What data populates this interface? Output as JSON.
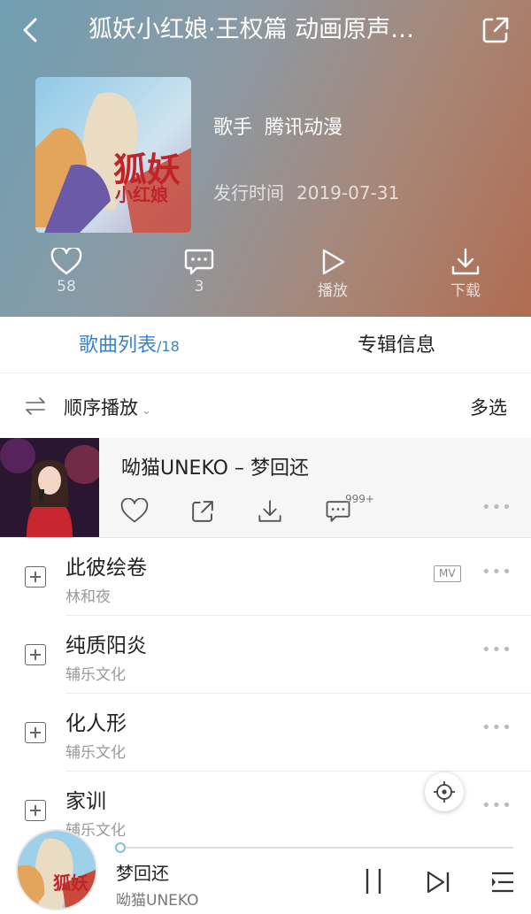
{
  "header": {
    "title": "狐妖小红娘·王权篇 动画原声…",
    "artist_label": "歌手",
    "artist_name": "腾讯动漫",
    "release_label": "发行时间",
    "release_date": "2019-07-31"
  },
  "actions": {
    "like_count": "58",
    "comment_count": "3",
    "play_label": "播放",
    "download_label": "下载"
  },
  "tabs": {
    "songs_label": "歌曲列表",
    "songs_count": "/18",
    "album_info_label": "专辑信息"
  },
  "toolbar": {
    "play_order_label": "顺序播放",
    "multi_select_label": "多选"
  },
  "now_playing": {
    "title": "呦猫UNEKO – 梦回还",
    "comment_badge": "999+"
  },
  "songs": [
    {
      "name": "此彼绘卷",
      "artist": "林和夜",
      "mv": "MV"
    },
    {
      "name": "纯质阳炎",
      "artist": "辅乐文化"
    },
    {
      "name": "化人形",
      "artist": "辅乐文化"
    },
    {
      "name": "家训",
      "artist": "辅乐文化"
    }
  ],
  "player": {
    "song": "梦回还",
    "artist": "呦猫UNEKO",
    "progress": 0.01
  },
  "colors": {
    "accent": "#3b82c4",
    "progress": "#7cc0e4"
  }
}
